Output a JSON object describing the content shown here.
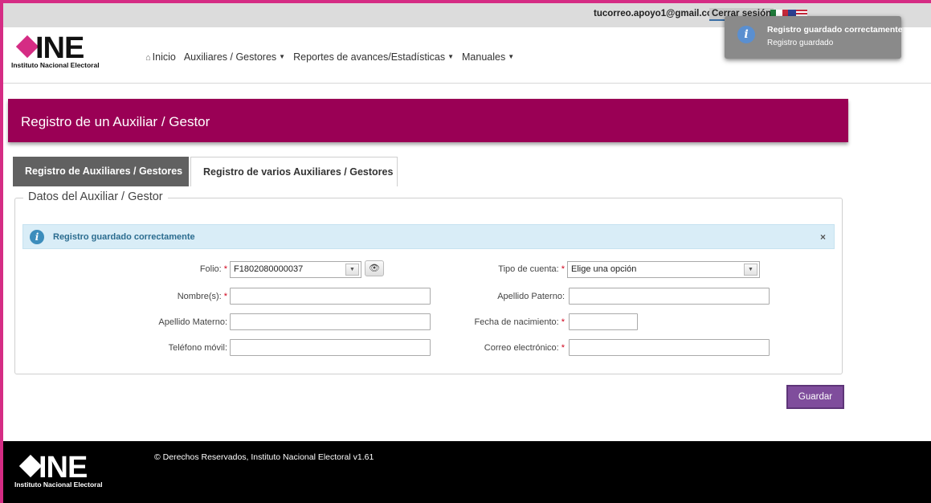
{
  "topbar": {
    "email": "tucorreo.apoyo1@gmail.com",
    "logout_label": "Cerrar sesión"
  },
  "header": {
    "logo_word": "INE",
    "logo_sub": "Instituto Nacional Electoral",
    "nav": [
      {
        "label": "Inicio",
        "icon": "home-icon"
      },
      {
        "label": "Auxiliares / Gestores",
        "has_caret": true
      },
      {
        "label": "Reportes de avances/Estadísticas",
        "has_caret": true
      },
      {
        "label": "Manuales",
        "has_caret": true
      }
    ]
  },
  "banner": {
    "title": "Registro de un Auxiliar / Gestor"
  },
  "tabs": [
    {
      "label": "Registro de Auxiliares / Gestores",
      "active": true
    },
    {
      "label": "Registro de varios Auxiliares / Gestores",
      "active": false
    }
  ],
  "form": {
    "legend": "Datos del Auxiliar / Gestor",
    "alert": "Registro guardado correctamente",
    "alert_close": "×",
    "required_mark": "*",
    "fields": {
      "folio": {
        "label": "Folio:",
        "value": "F1802080000037"
      },
      "tipo_cuenta": {
        "label": "Tipo de cuenta:",
        "value": "Elige una opción"
      },
      "nombres": {
        "label": "Nombre(s):",
        "value": ""
      },
      "apellido_paterno": {
        "label": "Apellido Paterno:",
        "value": ""
      },
      "apellido_materno": {
        "label": "Apellido Materno:",
        "value": ""
      },
      "fecha_nacimiento": {
        "label": "Fecha de nacimiento:",
        "value": ""
      },
      "telefono": {
        "label": "Teléfono móvil:",
        "value": ""
      },
      "correo": {
        "label": "Correo electrónico:",
        "value": ""
      }
    },
    "save_label": "Guardar"
  },
  "toast": {
    "title": "Registro guardado correctamente",
    "message": "Registro guardado"
  },
  "footer": {
    "logo_word": "INE",
    "logo_sub": "Instituto Nacional Electoral",
    "copyright": "© Derechos Reservados, Instituto Nacional Electoral v1.61"
  },
  "colors": {
    "brand_magenta": "#9a0055",
    "frame_pink": "#d52c84",
    "save_purple": "#7f4d9c",
    "alert_bg": "#d9edf7"
  }
}
